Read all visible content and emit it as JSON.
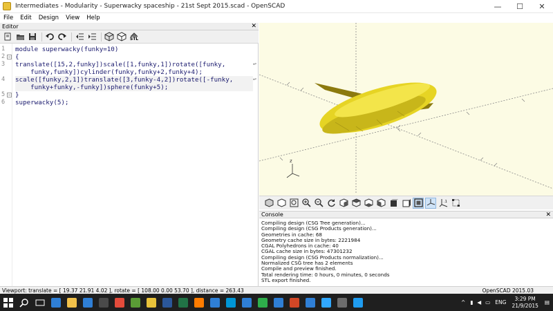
{
  "window": {
    "title": "Intermediates - Modularity - Superwacky spaceship - 21st Sept 2015.scad - OpenSCAD",
    "minimize": "—",
    "maximize": "☐",
    "close": "✕"
  },
  "menu": [
    "File",
    "Edit",
    "Design",
    "View",
    "Help"
  ],
  "editor": {
    "label": "Editor",
    "close": "✕",
    "toolbar_icons": [
      "new-file-icon",
      "open-file-icon",
      "save-icon",
      "undo-icon",
      "redo-icon",
      "unindent-icon",
      "indent-icon",
      "preview-icon",
      "render-icon",
      "export-stl-icon"
    ],
    "stl_label": "STL",
    "line_numbers": [
      "1",
      "2",
      "3",
      "",
      "4",
      "",
      "5",
      "6"
    ],
    "lines": [
      "module superwacky(funky=10)",
      "{",
      "translate([15,2,funky])scale([1,funky,1])rotate([funky,",
      "    funky,funky])cylinder(funky,funky+2,funky+4);",
      "scale([funky,2,1])translate([3,funky-4,2])rotate([-funky,",
      "    funky+funky,-funky])sphere(funky+5);",
      "}",
      "superwacky(5);"
    ]
  },
  "viewport": {
    "axis_label_z": "z",
    "colors": {
      "background": "#fcfbe4",
      "body": "#e8d623",
      "body_dark": "#b3a315",
      "fin": "#8b7a10"
    }
  },
  "view_toolbar_icons": [
    "preview-icon",
    "render-icon",
    "zoom-all-icon",
    "zoom-in-icon",
    "zoom-out-icon",
    "reset-view-icon",
    "view-right-icon",
    "view-top-icon",
    "view-bottom-icon",
    "view-left-icon",
    "view-front-icon",
    "view-back-icon",
    "view-diagonal-icon",
    "view-center-icon",
    "perspective-icon",
    "orthogonal-icon",
    "show-axes-icon",
    "show-scale-icon",
    "show-edges-icon"
  ],
  "console": {
    "label": "Console",
    "close": "✕",
    "lines": [
      "Compiling design (CSG Tree generation)...",
      "Compiling design (CSG Products generation)...",
      "Geometries in cache: 68",
      "Geometry cache size in bytes: 2221984",
      "CGAL Polyhedrons in cache: 40",
      "CGAL cache size in bytes: 47301232",
      "Compiling design (CSG Products normalization)...",
      "Normalized CSG tree has 2 elements",
      "Compile and preview finished.",
      "Total rendering time: 0 hours, 0 minutes, 0 seconds",
      "STL export finished."
    ]
  },
  "status": {
    "viewport": "Viewport: translate = [ 19.37 21.91 4.02 ], rotate = [ 108.00 0.00 53.70 ], distance = 263.43",
    "version": "OpenSCAD 2015.03"
  },
  "taskbar": {
    "icons": [
      {
        "name": "windows-start-icon",
        "color": "#ffffff"
      },
      {
        "name": "search-icon",
        "color": "#ffffff"
      },
      {
        "name": "task-view-icon",
        "color": "#ffffff"
      },
      {
        "name": "edge-icon",
        "color": "#2f7fd6"
      },
      {
        "name": "file-explorer-icon",
        "color": "#f2c14a"
      },
      {
        "name": "store-icon",
        "color": "#2f7fd6"
      },
      {
        "name": "calculator-icon",
        "color": "#4a4a4a"
      },
      {
        "name": "chrome-icon",
        "color": "#e34b3b"
      },
      {
        "name": "media-icon",
        "color": "#5a9c36"
      },
      {
        "name": "openscad-icon",
        "color": "#e9c23a"
      },
      {
        "name": "word-icon",
        "color": "#2b579a"
      },
      {
        "name": "excel-icon",
        "color": "#217346"
      },
      {
        "name": "illustrator-icon",
        "color": "#ff7c00"
      },
      {
        "name": "photos-icon",
        "color": "#2f7fd6"
      },
      {
        "name": "hp-icon",
        "color": "#0096d6"
      },
      {
        "name": "mail-icon",
        "color": "#2f7fd6"
      },
      {
        "name": "app-green-icon",
        "color": "#2eae4b"
      },
      {
        "name": "mobile-icon",
        "color": "#2f7fd6"
      },
      {
        "name": "powerpoint-icon",
        "color": "#d24726"
      },
      {
        "name": "downloads-icon",
        "color": "#2f7fd6"
      },
      {
        "name": "photoshop-icon",
        "color": "#31a8ff"
      },
      {
        "name": "code-icon",
        "color": "#6c6c6c"
      },
      {
        "name": "vscode-icon",
        "color": "#1f9cf0"
      }
    ],
    "tray_lang": "ENG",
    "time": "3:29 PM",
    "date": "21/9/2015",
    "tray_chevron": "^"
  }
}
